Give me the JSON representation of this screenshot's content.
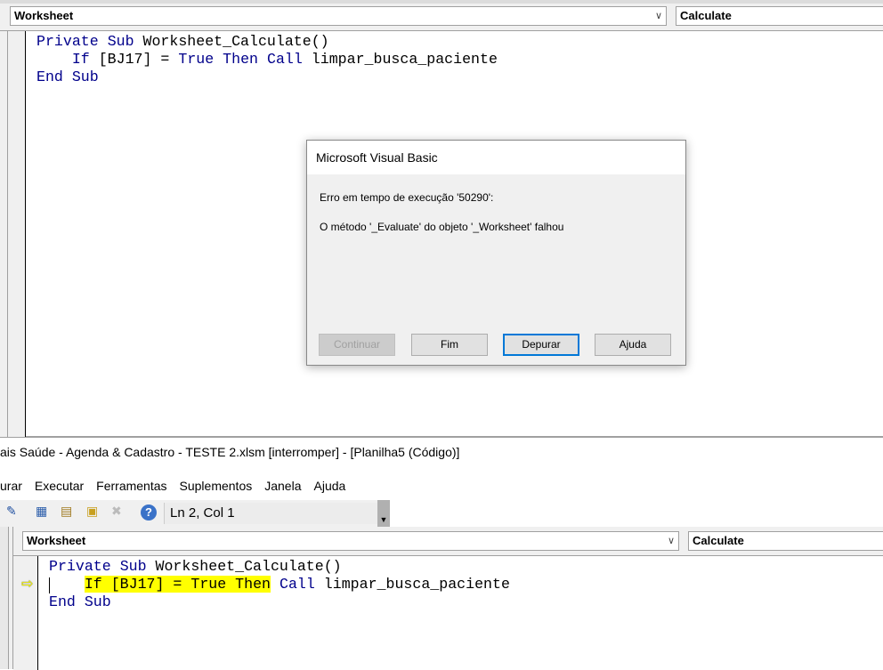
{
  "top_pane": {
    "object_combo": "Worksheet",
    "proc_combo": "Calculate"
  },
  "code": {
    "line1": {
      "kw1": "Private",
      "kw2": "Sub",
      "rest": " Worksheet_Calculate()"
    },
    "line2": {
      "indent": "    ",
      "kw_if": "If",
      "cond": " [BJ17] = ",
      "kw_true": "True",
      "kw_then": "Then",
      "kw_call": "Call",
      "rest": " limpar_busca_paciente"
    },
    "line3": {
      "kw1": "End",
      "kw2": "Sub"
    }
  },
  "dialog": {
    "title": "Microsoft Visual Basic",
    "error_line": "Erro em tempo de execução '50290':",
    "message": "O método '_Evaluate' do objeto '_Worksheet' falhou",
    "buttons": {
      "continue": "Continuar",
      "end": "Fim",
      "debug": "Depurar",
      "help": "Ajuda"
    }
  },
  "window_title": "ais Saúde - Agenda & Cadastro - TESTE 2.xlsm [interromper] - [Planilha5 (Código)]",
  "menu": [
    "urar",
    "Executar",
    "Ferramentas",
    "Suplementos",
    "Janela",
    "Ajuda"
  ],
  "toolbar": {
    "position": "Ln 2, Col 1"
  },
  "bottom_pane": {
    "object_combo": "Worksheet",
    "proc_combo": "Calculate"
  },
  "colors": {
    "keyword": "#00008b",
    "highlight": "#ffff00",
    "focus": "#0078d7"
  }
}
